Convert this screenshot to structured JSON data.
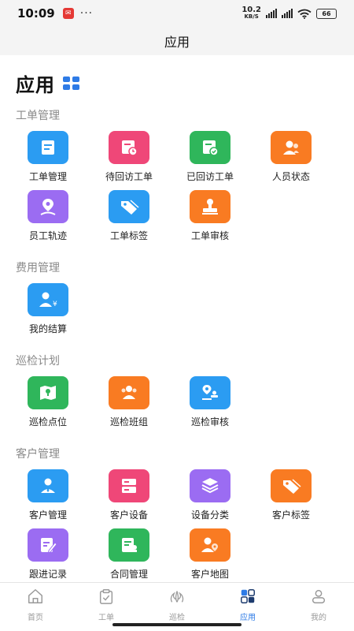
{
  "status_bar": {
    "time": "10:09",
    "speed_value": "10.2",
    "speed_unit": "KB/S",
    "battery": "66"
  },
  "nav": {
    "title": "应用"
  },
  "page": {
    "title": "应用"
  },
  "sections": [
    {
      "title": "工单管理",
      "items": [
        {
          "label": "工单管理",
          "icon": "document-icon",
          "color": "#2b9cf2"
        },
        {
          "label": "待回访工单",
          "icon": "pending-visit-icon",
          "color": "#ef4778"
        },
        {
          "label": "已回访工单",
          "icon": "visited-check-icon",
          "color": "#2fb65b"
        },
        {
          "label": "人员状态",
          "icon": "staff-status-icon",
          "color": "#f97b22"
        },
        {
          "label": "员工轨迹",
          "icon": "location-track-icon",
          "color": "#9b6cf2"
        },
        {
          "label": "工单标签",
          "icon": "tag-icon",
          "color": "#2b9cf2"
        },
        {
          "label": "工单审核",
          "icon": "stamp-icon",
          "color": "#f97b22"
        }
      ]
    },
    {
      "title": "费用管理",
      "items": [
        {
          "label": "我的结算",
          "icon": "settlement-icon",
          "color": "#2b9cf2"
        }
      ]
    },
    {
      "title": "巡检计划",
      "items": [
        {
          "label": "巡检点位",
          "icon": "map-point-icon",
          "color": "#2fb65b"
        },
        {
          "label": "巡检班组",
          "icon": "team-icon",
          "color": "#f97b22"
        },
        {
          "label": "巡检审核",
          "icon": "inspection-review-icon",
          "color": "#2b9cf2"
        }
      ]
    },
    {
      "title": "客户管理",
      "items": [
        {
          "label": "客户管理",
          "icon": "customer-icon",
          "color": "#2b9cf2"
        },
        {
          "label": "客户设备",
          "icon": "device-icon",
          "color": "#ef4778"
        },
        {
          "label": "设备分类",
          "icon": "layers-icon",
          "color": "#9b6cf2"
        },
        {
          "label": "客户标签",
          "icon": "tag-icon",
          "color": "#f97b22"
        },
        {
          "label": "跟进记录",
          "icon": "edit-record-icon",
          "color": "#9b6cf2"
        },
        {
          "label": "合同管理",
          "icon": "contract-icon",
          "color": "#2fb65b"
        },
        {
          "label": "客户地图",
          "icon": "customer-map-icon",
          "color": "#f97b22"
        }
      ]
    }
  ],
  "tabs": [
    {
      "label": "首页",
      "icon": "home-icon",
      "active": false
    },
    {
      "label": "工单",
      "icon": "clipboard-icon",
      "active": false
    },
    {
      "label": "巡检",
      "icon": "inspection-icon",
      "active": false
    },
    {
      "label": "应用",
      "icon": "apps-icon",
      "active": true
    },
    {
      "label": "我的",
      "icon": "profile-icon",
      "active": false
    }
  ],
  "colors": {
    "accent": "#2e7be6",
    "section_title": "#8a8a8a",
    "tab_inactive": "#9a9a9a"
  }
}
